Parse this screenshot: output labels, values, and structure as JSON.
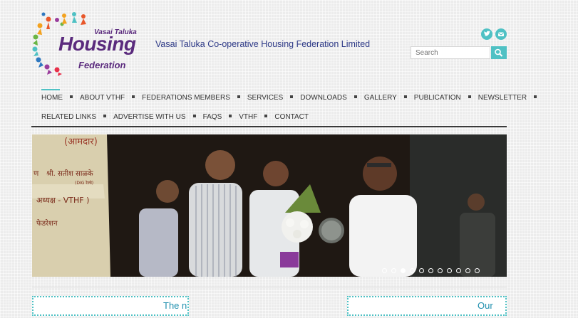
{
  "logo": {
    "line1": "Vasai Taluka",
    "line2": "Housing",
    "line3": "Federation"
  },
  "site_title": "Vasai Taluka Co-operative Housing Federation Limited",
  "social": {
    "twitter_icon": "twitter-icon",
    "email_icon": "email-icon",
    "accent": "#4fc1c4"
  },
  "search": {
    "placeholder": "Search"
  },
  "nav": {
    "row1": [
      "HOME",
      "ABOUT VTHF",
      "FEDERATIONS MEMBERS",
      "SERVICES",
      "DOWNLOADS",
      "GALLERY",
      "PUBLICATION",
      "NEWSLETTER"
    ],
    "row2": [
      "RELATED LINKS",
      "ADVERTISE WITH US",
      "FAQS",
      "VTHF",
      "CONTACT"
    ]
  },
  "slider": {
    "banner_text_1": "(आमदार)",
    "banner_text_2": "श्री. सतीश साळके",
    "banner_text_3": "(DIG रेल्वे)",
    "banner_text_4": "अध्यक्ष - VTHF )",
    "banner_text_5": "फेडरेशन",
    "banner_text_6": "ण",
    "dots_count": 11,
    "active_dot": 2
  },
  "sections": {
    "left_title": "The n",
    "right_title": "Our"
  }
}
